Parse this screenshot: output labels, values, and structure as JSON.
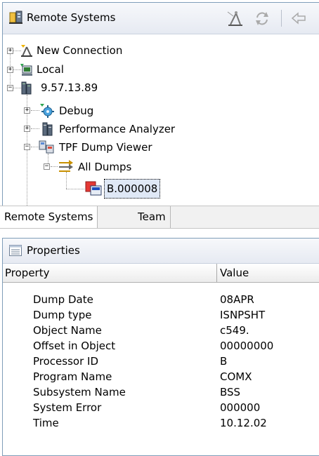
{
  "remote_systems": {
    "title": "Remote Systems",
    "toolbar_icons": [
      "new-connection-icon",
      "refresh-icon",
      "back-arrow-icon"
    ],
    "tree": [
      {
        "label": "New Connection",
        "icon": "new-connection-icon",
        "expanded": false
      },
      {
        "label": "Local",
        "icon": "local-computer-icon",
        "expanded": false
      },
      {
        "label": "9.57.13.89",
        "icon": "server-icon",
        "expanded": true
      },
      {
        "label": "Debug",
        "icon": "debug-icon",
        "expanded": false
      },
      {
        "label": "Performance Analyzer",
        "icon": "performance-icon",
        "expanded": false
      },
      {
        "label": "TPF Dump Viewer",
        "icon": "dump-viewer-icon",
        "expanded": true
      },
      {
        "label": "All Dumps",
        "icon": "all-dumps-icon",
        "expanded": true
      },
      {
        "label": "B.000008",
        "icon": "dump-file-icon",
        "selected": true
      }
    ]
  },
  "tabs": [
    {
      "label": "Remote Systems",
      "active": true
    },
    {
      "label": "Team",
      "active": false
    }
  ],
  "properties": {
    "title": "Properties",
    "col_property": "Property",
    "col_value": "Value",
    "rows": [
      {
        "name": "Dump Date",
        "value": "08APR"
      },
      {
        "name": "Dump type",
        "value": "ISNPSHT"
      },
      {
        "name": "Object Name",
        "value": "c549."
      },
      {
        "name": "Offset in Object",
        "value": "00000000"
      },
      {
        "name": "Processor ID",
        "value": "B"
      },
      {
        "name": "Program Name",
        "value": "COMX"
      },
      {
        "name": "Subsystem Name",
        "value": "BSS"
      },
      {
        "name": "System Error",
        "value": "000000"
      },
      {
        "name": "Time",
        "value": "10.12.02"
      }
    ]
  }
}
